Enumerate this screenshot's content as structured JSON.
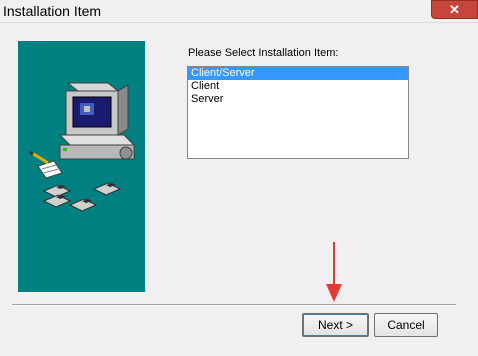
{
  "window": {
    "title": "Installation Item",
    "close_label": "✕"
  },
  "prompt": "Please Select Installation Item:",
  "list": {
    "items": [
      "Client/Server",
      "Client",
      "Server"
    ],
    "selected_index": 0
  },
  "buttons": {
    "next": "Next >",
    "cancel": "Cancel"
  },
  "icons": {
    "panel_art": "computer-with-disks-icon",
    "annotation": "red-arrow-icon"
  },
  "colors": {
    "panel": "#008080",
    "selection": "#3399ff",
    "close": "#c7463c",
    "arrow": "#e53935"
  }
}
